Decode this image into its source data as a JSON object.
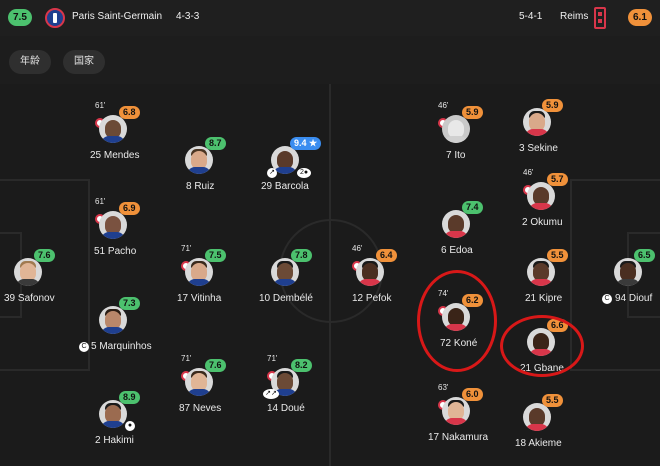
{
  "header": {
    "home": {
      "rating": "7.5",
      "name": "Paris Saint-Germain",
      "formation": "4-3-3"
    },
    "away": {
      "rating": "6.1",
      "name": "Reims",
      "formation": "5-4-1"
    }
  },
  "filters": {
    "age": "年龄",
    "country": "国家"
  },
  "players": {
    "mendes": {
      "name": "25 Mendes",
      "rating": "6.8",
      "sub": "61'"
    },
    "ruiz": {
      "name": "8 Ruiz",
      "rating": "8.7"
    },
    "barcola": {
      "name": "29 Barcola",
      "rating": "9.4 ★"
    },
    "pacho": {
      "name": "51 Pacho",
      "rating": "6.9",
      "sub": "61'"
    },
    "safonov": {
      "name": "39 Safonov",
      "rating": "7.6"
    },
    "vitinha": {
      "name": "17 Vitinha",
      "rating": "7.5",
      "sub": "71'"
    },
    "dembele": {
      "name": "10 Dembélé",
      "rating": "7.8"
    },
    "pefok": {
      "name": "12 Pefok",
      "rating": "6.4",
      "sub": "46'"
    },
    "marquinhos": {
      "name": "5 Marquinhos",
      "rating": "7.3",
      "captain": "C"
    },
    "neves": {
      "name": "87 Neves",
      "rating": "7.6",
      "sub": "71'"
    },
    "doue": {
      "name": "14 Doué",
      "rating": "8.2",
      "sub": "71'"
    },
    "hakimi": {
      "name": "2 Hakimi",
      "rating": "8.9"
    },
    "ito": {
      "name": "7 Ito",
      "rating": "5.9",
      "sub": "46'"
    },
    "sekine": {
      "name": "3 Sekine",
      "rating": "5.9"
    },
    "okumu": {
      "name": "2 Okumu",
      "rating": "5.7",
      "sub": "46'"
    },
    "edoa": {
      "name": "6 Edoa",
      "rating": "7.4"
    },
    "kipre": {
      "name": "21 Kipre",
      "rating": "5.5"
    },
    "diouf": {
      "name": "94 Diouf",
      "rating": "6.5",
      "captain": "C"
    },
    "kone": {
      "name": "72 Koné",
      "rating": "6.2",
      "sub": "74'"
    },
    "gbane": {
      "name": "21 Gbane",
      "rating": "6.6"
    },
    "nakamura": {
      "name": "17 Nakamura",
      "rating": "6.0",
      "sub": "63'"
    },
    "akieme": {
      "name": "18 Akieme",
      "rating": "5.5"
    }
  },
  "colors": {
    "good_rating": "#4cc16e",
    "poor_rating": "#f0913a",
    "top_rating": "#3a8df0",
    "highlight_circle": "#d81818"
  }
}
